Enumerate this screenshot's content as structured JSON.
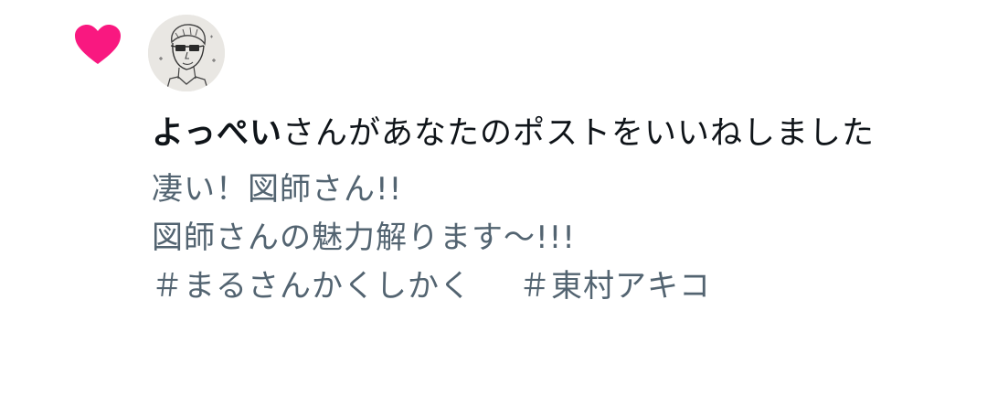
{
  "notification": {
    "type_icon": "heart-icon",
    "accent_color": "#f91880",
    "avatar_icon": "user-avatar-sketch",
    "user_name": "よっぺい",
    "action_text": "さんがあなたのポストをいいねしました",
    "post": {
      "lines": [
        "凄い！図師さん!!",
        "図師さんの魅力解ります〜!!!"
      ],
      "hashtags": [
        "＃まるさんかくしかく",
        "＃東村アキコ"
      ]
    }
  }
}
